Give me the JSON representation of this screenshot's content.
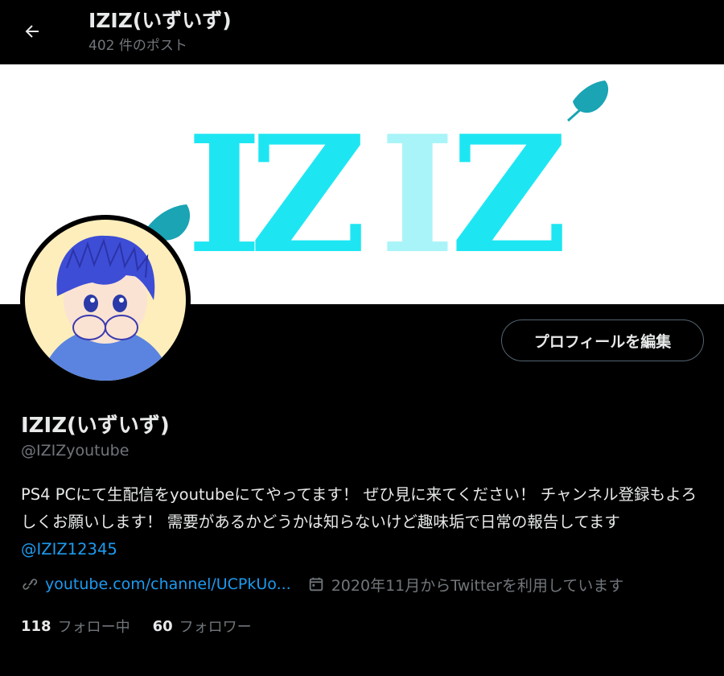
{
  "header": {
    "title": "IZIZ(いずいず)",
    "post_count": "402 件のポスト"
  },
  "banner": {
    "logo_text": "IZIZ",
    "colors": {
      "primary": "#1de6f2",
      "light": "#a8f4f8",
      "feather": "#1aa4b4"
    }
  },
  "profile": {
    "edit_button_label": "プロフィールを編集",
    "display_name": "IZIZ(いずいず)",
    "handle": "@IZIZyoutube",
    "bio_text": "PS4 PCにて生配信をyoutubeにてやってます！ ぜひ見に来てください！ チャンネル登録もよろしくお願いします！ 需要があるかどうかは知らないけど趣味垢で日常の報告してます",
    "bio_mention": "@IZIZ12345",
    "link_text": "youtube.com/channel/UCPkUo...",
    "joined_text": "2020年11月からTwitterを利用しています",
    "following_count": "118",
    "following_label": "フォロー中",
    "followers_count": "60",
    "followers_label": "フォロワー"
  },
  "icons": {
    "back": "back-arrow-icon",
    "link": "link-icon",
    "calendar": "calendar-icon"
  },
  "colors": {
    "background": "#000000",
    "text": "#e7e9ea",
    "muted": "#71767b",
    "accent": "#1d9bf0",
    "border": "#536471"
  }
}
